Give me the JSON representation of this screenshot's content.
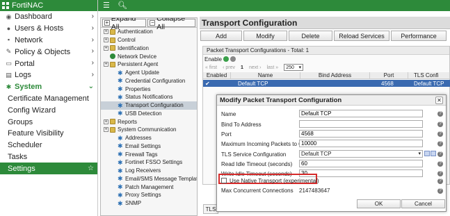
{
  "app": {
    "title": "FortiNAC",
    "accent_color": "#2d8a3a"
  },
  "nav": {
    "items": [
      {
        "label": "Dashboard",
        "icon": "dashboard-icon"
      },
      {
        "label": "Users & Hosts",
        "icon": "users-icon"
      },
      {
        "label": "Network",
        "icon": "network-icon"
      },
      {
        "label": "Policy & Objects",
        "icon": "policy-icon"
      },
      {
        "label": "Portal",
        "icon": "portal-icon"
      },
      {
        "label": "Logs",
        "icon": "logs-icon"
      },
      {
        "label": "System",
        "icon": "gear-icon"
      }
    ],
    "system_subitems": [
      "Certificate Management",
      "Config Wizard",
      "Groups",
      "Feature Visibility",
      "Scheduler",
      "Tasks",
      "Settings"
    ],
    "active": "Settings"
  },
  "tree": {
    "expand_label": "Expand All",
    "collapse_label": "Collapse All",
    "rows": [
      {
        "label": "Authentication",
        "level": 0,
        "icon": "folder"
      },
      {
        "label": "Control",
        "level": 0,
        "icon": "folder"
      },
      {
        "label": "Identification",
        "level": 0,
        "icon": "folder"
      },
      {
        "label": "Network Device",
        "level": 0,
        "icon": "ball"
      },
      {
        "label": "Persistent Agent",
        "level": 0,
        "icon": "folder"
      },
      {
        "label": "Agent Update",
        "level": 1,
        "icon": "gear"
      },
      {
        "label": "Credential Configuration",
        "level": 1,
        "icon": "gear"
      },
      {
        "label": "Properties",
        "level": 1,
        "icon": "gear"
      },
      {
        "label": "Status Notifications",
        "level": 1,
        "icon": "gear"
      },
      {
        "label": "Transport Configuration",
        "level": 1,
        "icon": "gear",
        "selected": true
      },
      {
        "label": "USB Detection",
        "level": 1,
        "icon": "gear"
      },
      {
        "label": "Reports",
        "level": 0,
        "icon": "folder"
      },
      {
        "label": "System Communication",
        "level": 0,
        "icon": "folder"
      },
      {
        "label": "Addresses",
        "level": 1,
        "icon": "gear"
      },
      {
        "label": "Email Settings",
        "level": 1,
        "icon": "gear"
      },
      {
        "label": "Firewall Tags",
        "level": 1,
        "icon": "gear"
      },
      {
        "label": "Fortinet FSSO Settings",
        "level": 1,
        "icon": "gear"
      },
      {
        "label": "Log Receivers",
        "level": 1,
        "icon": "gear"
      },
      {
        "label": "Email/SMS Message Templates",
        "level": 1,
        "icon": "gear"
      },
      {
        "label": "Patch Management",
        "level": 1,
        "icon": "gear"
      },
      {
        "label": "Proxy Settings",
        "level": 1,
        "icon": "gear"
      },
      {
        "label": "SNMP",
        "level": 1,
        "icon": "gear"
      }
    ]
  },
  "main": {
    "title": "Transport Configuration",
    "actions": [
      "Add",
      "Modify",
      "Delete",
      "Reload Services",
      "Performance"
    ],
    "panel_header": "Packet Transport Configurations - Total: 1",
    "enable_label": "Enable",
    "pager": {
      "first": "« first",
      "prev": "‹ prev",
      "page": "1",
      "next": "next ›",
      "last": "last »",
      "page_size": "250"
    },
    "grid": {
      "columns": [
        "Enabled",
        "Name",
        "Bind Address",
        "Port",
        "TLS Confi"
      ],
      "row": {
        "name": "Default TCP",
        "bind_address": "",
        "port": "4568",
        "tls": "Default TCP"
      }
    },
    "bottom_tab": "TLS"
  },
  "modal": {
    "title": "Modify Packet Transport Configuration",
    "fields": [
      {
        "label": "Name",
        "value": "Default TCP"
      },
      {
        "label": "Bind To Address",
        "value": ""
      },
      {
        "label": "Port",
        "value": "4568"
      },
      {
        "label": "Maximum Incoming Packets to Queue",
        "value": "10000"
      },
      {
        "label": "TLS Service Configuration",
        "value": "Default TCP"
      },
      {
        "label": "Read Idle Timeout (seconds)",
        "value": "60"
      },
      {
        "label": "Write Idle Timeout (seconds)",
        "value": "30"
      },
      {
        "label": "Use Native Transport (experimental)",
        "value": ""
      },
      {
        "label": "Max Concurrent Connections",
        "value": "2147483647"
      }
    ],
    "ok_label": "OK",
    "cancel_label": "Cancel",
    "highlight_color": "#d62a2a"
  }
}
